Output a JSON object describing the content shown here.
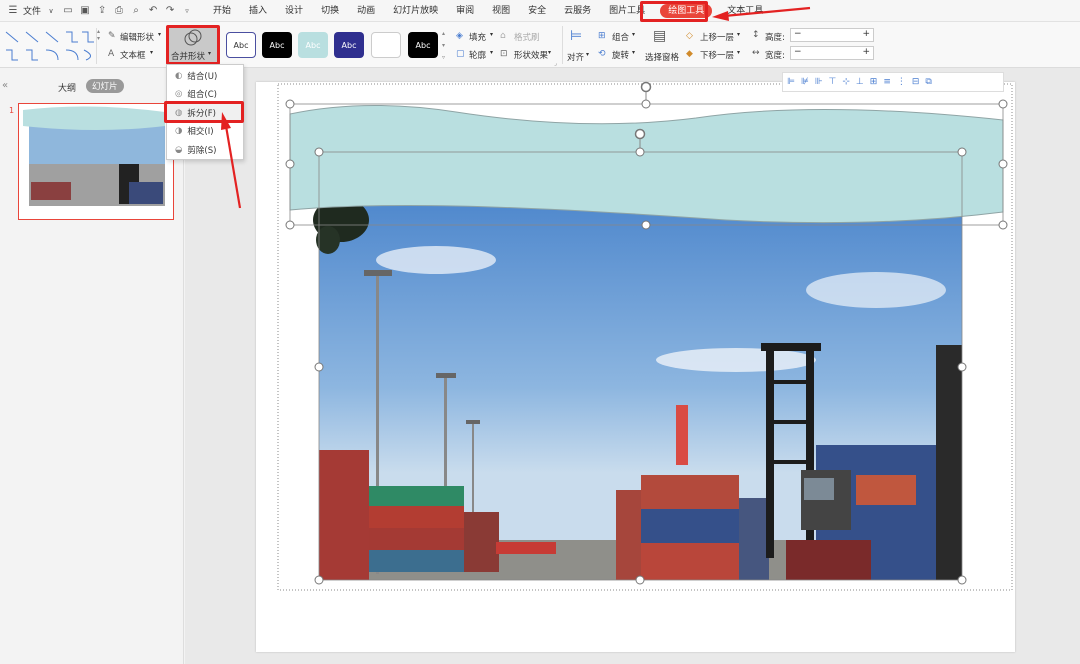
{
  "menubar": {
    "file_label": "文件",
    "tabs": [
      "开始",
      "插入",
      "设计",
      "切换",
      "动画",
      "幻灯片放映",
      "审阅",
      "视图",
      "安全",
      "云服务",
      "图片工具"
    ],
    "active_tab": "绘图工具",
    "last_tab": "文本工具"
  },
  "ribbon": {
    "edit_shape": "编辑形状",
    "text_box": "文本框",
    "merge_shapes": "合并形状",
    "style_sample": "Abc",
    "fill": "填充",
    "format_brush": "格式刷",
    "outline": "轮廓",
    "shape_effects": "形状效果",
    "align": "对齐",
    "group": "组合",
    "rotate": "旋转",
    "selection_pane": "选择窗格",
    "bring_forward": "上移一层",
    "send_backward": "下移一层",
    "height_label": "高度:",
    "width_label": "宽度:"
  },
  "merge_menu": {
    "items": [
      {
        "label": "结合(U)",
        "icon": "union-icon"
      },
      {
        "label": "组合(C)",
        "icon": "combine-icon"
      },
      {
        "label": "拆分(F)",
        "icon": "fragment-icon"
      },
      {
        "label": "相交(I)",
        "icon": "intersect-icon"
      },
      {
        "label": "剪除(S)",
        "icon": "subtract-icon"
      }
    ],
    "highlighted_index": 2
  },
  "sidebar": {
    "collapse_icon": "«",
    "tab_outline": "大纲",
    "tab_slides": "幻灯片",
    "slide_number": "1"
  },
  "theme": {
    "accent": "#e32222",
    "wave_fill": "#b9dfe0",
    "active_tab": "#e9453a"
  }
}
